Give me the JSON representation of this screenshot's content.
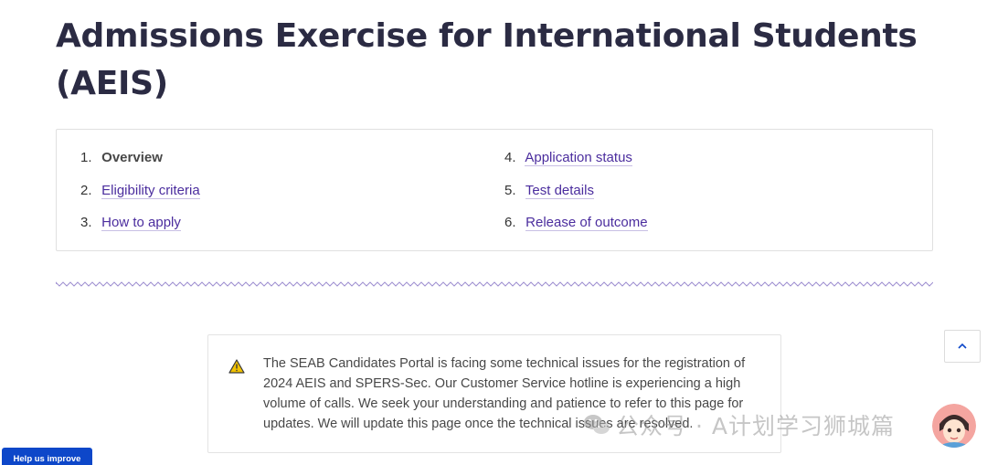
{
  "page": {
    "title": "Admissions Exercise for International Students (AEIS)"
  },
  "toc": {
    "items": [
      {
        "num": "1.",
        "label": "Overview"
      },
      {
        "num": "2.",
        "label": "Eligibility criteria"
      },
      {
        "num": "3.",
        "label": "How to apply"
      },
      {
        "num": "4.",
        "label": "Application status"
      },
      {
        "num": "5.",
        "label": "Test details"
      },
      {
        "num": "6.",
        "label": "Release of outcome"
      }
    ]
  },
  "notice": {
    "icon": "warning-icon",
    "text": "The SEAB Candidates Portal is facing some technical issues for the registration of 2024 AEIS and SPERS-Sec. Our Customer Service hotline is experiencing a high volume of calls. We seek your understanding and patience to refer to this page for updates. We will update this page once the technical issues are resolved."
  },
  "controls": {
    "back_to_top_icon": "chevron-up-icon",
    "help_label": "Help us improve"
  },
  "watermark": {
    "text": "公众号 · A计划学习狮城篇"
  },
  "colors": {
    "title": "#2b2b43",
    "link": "#4b2d9e",
    "help_button": "#0d47c9",
    "wave": "#9e8fd0",
    "warning": "#f2c200"
  }
}
